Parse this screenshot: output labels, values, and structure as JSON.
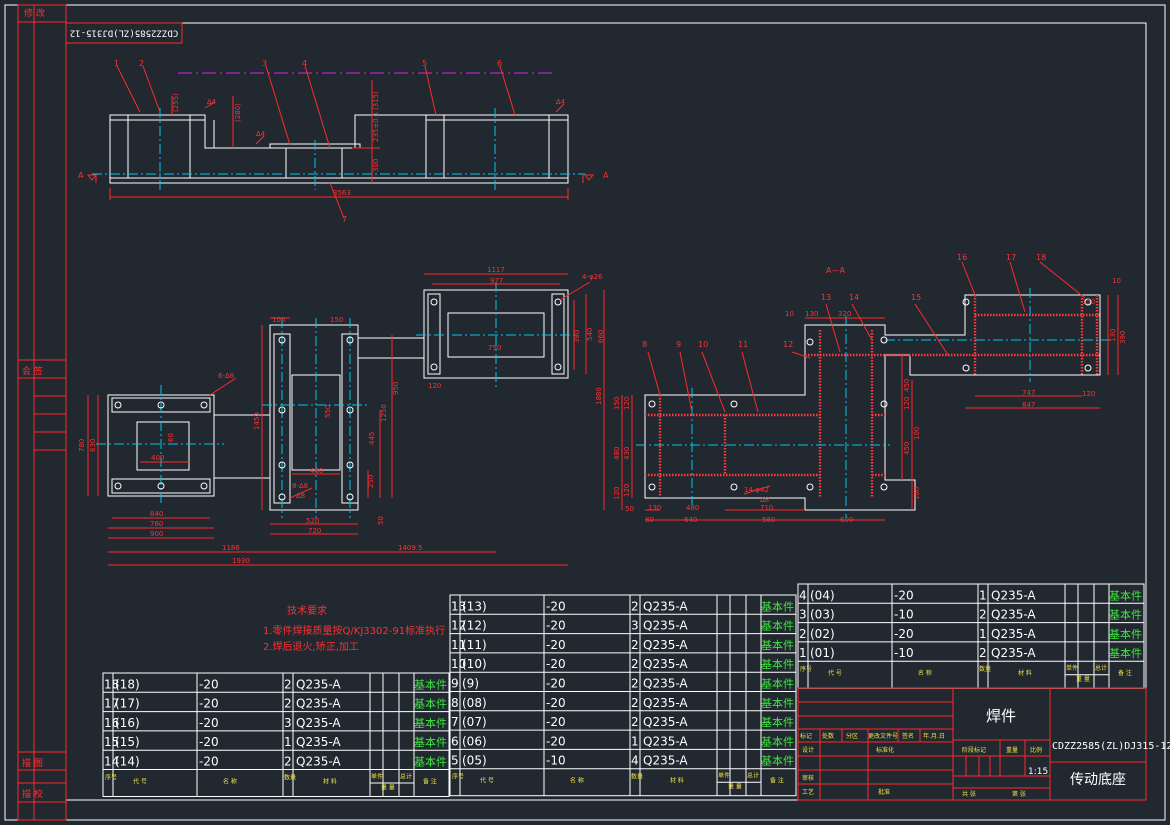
{
  "margin_left": {
    "revision": "修 改",
    "common": "会 签",
    "trace": "描 图",
    "check": "描 校"
  },
  "corner_code": "CDZZ2585(ZL)DJ315-12",
  "section_label": "A—A",
  "section_marks": [
    "A",
    "A"
  ],
  "top_callouts": [
    "1",
    "2",
    "3",
    "4",
    "5",
    "6",
    "7"
  ],
  "right_callouts": [
    "8",
    "9",
    "10",
    "11",
    "12",
    "13",
    "14",
    "15",
    "16",
    "17",
    "18"
  ],
  "weld_notes": [
    "6-∆8",
    "8-∆8",
    "∆8",
    "8-∆8",
    "∆8",
    "4-φ26",
    "14-φ42"
  ],
  "dims": {
    "top": [
      "(255)",
      "(280)",
      "(315)",
      "235±0.1",
      "300",
      "3563",
      "∆4",
      "∆4",
      "∆4"
    ],
    "left": [
      "1117",
      "977",
      "100",
      "150",
      "750",
      "380",
      "120",
      "540",
      "660",
      "1250",
      "950",
      "445",
      "1450",
      "550",
      "460",
      "250",
      "1880",
      "520",
      "720",
      "640",
      "760",
      "900",
      "1186",
      "1409.5",
      "1930",
      "780",
      "630",
      "400",
      "60",
      "50",
      "1450"
    ],
    "right": [
      "10",
      "130",
      "320",
      "150",
      "10",
      "130",
      "450",
      "120",
      "390",
      "747",
      "847",
      "120",
      "430",
      "480",
      "450",
      "120",
      "120",
      "100",
      "120",
      "150",
      "100",
      "480",
      "710",
      "560",
      "600",
      "640",
      "80",
      "50",
      "130"
    ]
  },
  "notes": {
    "title": "技术要求",
    "items": [
      "1.零件焊接质量按Q/KJ3302-91标准执行",
      "2.焊后退火,矫正,加工"
    ]
  },
  "bom_left": [
    {
      "no": "18",
      "code": "(18)",
      "spec": "-20",
      "qty": "2",
      "mat": "Q235-A",
      "note": "基本件"
    },
    {
      "no": "17",
      "code": "(17)",
      "spec": "-20",
      "qty": "2",
      "mat": "Q235-A",
      "note": "基本件"
    },
    {
      "no": "16",
      "code": "(16)",
      "spec": "-20",
      "qty": "3",
      "mat": "Q235-A",
      "note": "基本件"
    },
    {
      "no": "15",
      "code": "(15)",
      "spec": "-20",
      "qty": "1",
      "mat": "Q235-A",
      "note": "基本件"
    },
    {
      "no": "14",
      "code": "(14)",
      "spec": "-20",
      "qty": "2",
      "mat": "Q235-A",
      "note": "基本件"
    }
  ],
  "bom_mid": [
    {
      "no": "13",
      "code": "(13)",
      "spec": "-20",
      "qty": "2",
      "mat": "Q235-A",
      "note": "基本件"
    },
    {
      "no": "12",
      "code": "(12)",
      "spec": "-20",
      "qty": "3",
      "mat": "Q235-A",
      "note": "基本件"
    },
    {
      "no": "11",
      "code": "(11)",
      "spec": "-20",
      "qty": "2",
      "mat": "Q235-A",
      "note": "基本件"
    },
    {
      "no": "10",
      "code": "(10)",
      "spec": "-20",
      "qty": "2",
      "mat": "Q235-A",
      "note": "基本件"
    },
    {
      "no": "9",
      "code": "(9)",
      "spec": "-20",
      "qty": "2",
      "mat": "Q235-A",
      "note": "基本件"
    },
    {
      "no": "8",
      "code": "(08)",
      "spec": "-20",
      "qty": "2",
      "mat": "Q235-A",
      "note": "基本件"
    },
    {
      "no": "7",
      "code": "(07)",
      "spec": "-20",
      "qty": "2",
      "mat": "Q235-A",
      "note": "基本件"
    },
    {
      "no": "6",
      "code": "(06)",
      "spec": "-20",
      "qty": "1",
      "mat": "Q235-A",
      "note": "基本件"
    },
    {
      "no": "5",
      "code": "(05)",
      "spec": "-10",
      "qty": "4",
      "mat": "Q235-A",
      "note": "基本件"
    }
  ],
  "bom_right": [
    {
      "no": "4",
      "code": "(04)",
      "spec": "-20",
      "qty": "1",
      "mat": "Q235-A",
      "note": "基本件"
    },
    {
      "no": "3",
      "code": "(03)",
      "spec": "-10",
      "qty": "2",
      "mat": "Q235-A",
      "note": "基本件"
    },
    {
      "no": "2",
      "code": "(02)",
      "spec": "-20",
      "qty": "1",
      "mat": "Q235-A",
      "note": "基本件"
    },
    {
      "no": "1",
      "code": "(01)",
      "spec": "-10",
      "qty": "2",
      "mat": "Q235-A",
      "note": "基本件"
    }
  ],
  "bom_header": {
    "no": "序号",
    "code": "代 号",
    "name": "名 称",
    "qty": "数量",
    "mat": "材 料",
    "single": "单件",
    "total": "总计",
    "weight": "重 量",
    "note": "备 注"
  },
  "title_block": {
    "part_type": "焊件",
    "drawing_no": "CDZZ2585(ZL)DJ315-12",
    "part_name": "传动底座",
    "scale": "1:15",
    "labels": [
      "标记",
      "处数",
      "分区",
      "更改文件号",
      "签名",
      "年.月.日",
      "设计",
      "标准化",
      "阶段标记",
      "重量",
      "比例",
      "审核",
      "工艺",
      "批准",
      "共 张",
      "第 张"
    ]
  }
}
